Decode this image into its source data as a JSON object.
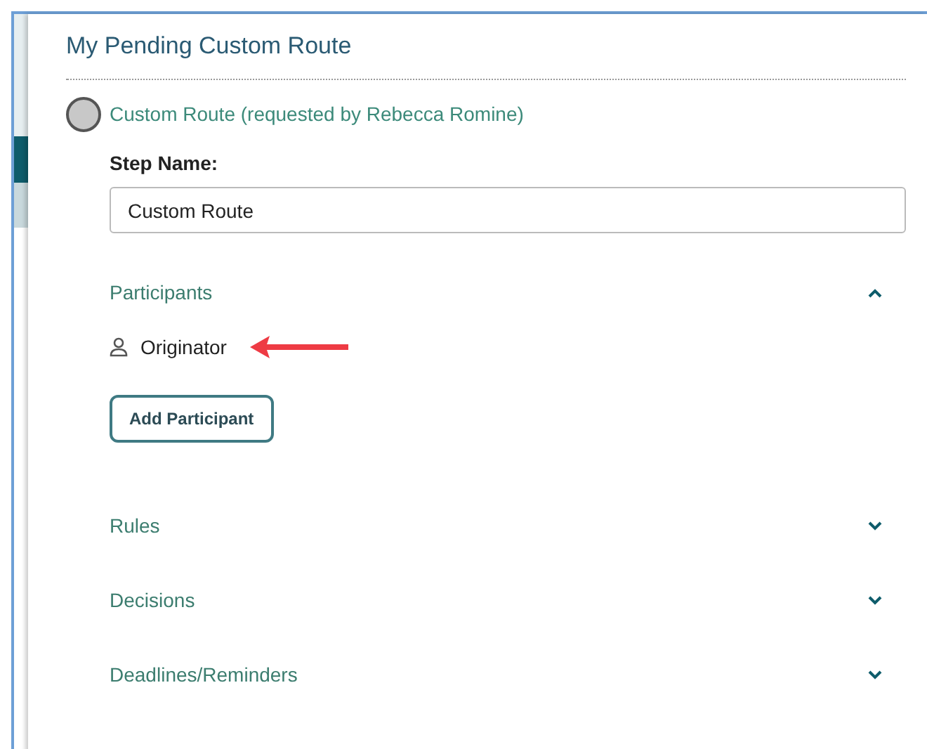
{
  "panel": {
    "title": "My Pending Custom Route"
  },
  "step": {
    "label": "Custom Route (requested by Rebecca Romine)",
    "completed": false
  },
  "step_name": {
    "label": "Step Name:",
    "value": "Custom Route"
  },
  "sections": [
    {
      "title": "Participants",
      "expanded": true,
      "participants": [
        "Originator"
      ],
      "add_button": "Add Participant"
    },
    {
      "title": "Rules",
      "expanded": false
    },
    {
      "title": "Decisions",
      "expanded": false
    },
    {
      "title": "Deadlines/Reminders",
      "expanded": false
    }
  ]
}
